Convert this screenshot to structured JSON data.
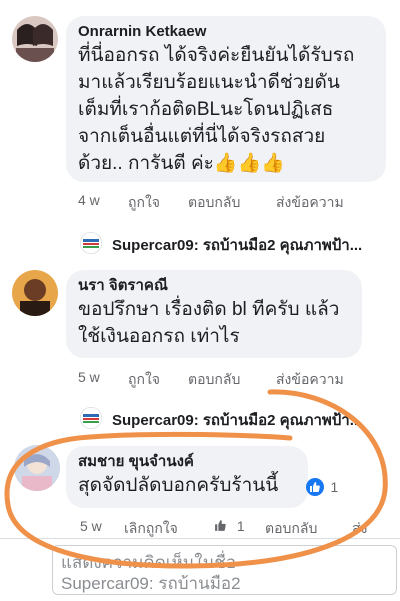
{
  "comments": [
    {
      "author": "Onrarnin Ketkaew",
      "text": "ที่นี่ออกรถ ได้จริงค่ะยืนยันได้รับรถ\nมาแล้วเรียบร้อยแนะนำดีช่วยดัน\nเต็มที่เราก้อติดBLนะโดนปฏิเสธ\nจากเต็นอื่นแต่ที่นี่ได้จริงรถสวย\nด้วย.. การันตี ค่ะ👍👍👍",
      "time": "4 w",
      "like": "ถูกใจ",
      "reply": "ตอบกลับ",
      "message": "ส่งข้อความ"
    },
    {
      "author": "นรา จิตราคณี",
      "text": "ขอปรึกษา เรื่องติด bl  ทีครับ แล้ว\nใช้เงินออกรถ เท่าไร",
      "time": "5 w",
      "like": "ถูกใจ",
      "reply": "ตอบกลับ",
      "message": "ส่งข้อความ"
    },
    {
      "author": "สมชาย ขุนจำนงค์",
      "text": "สุดจัดปลัดบอกครับร้านนี้",
      "time": "5 w",
      "unlike": "เลิกถูกใจ",
      "reaction_count": "1",
      "inline_reaction_count": "1",
      "reply": "ตอบกลับ",
      "message": "ส่ง"
    }
  ],
  "replies": [
    {
      "text": "Supercar09: รถบ้านมือ2 คุณภาพป้า..."
    },
    {
      "text": "Supercar09: รถบ้านมือ2 คุณภาพป้า..."
    }
  ],
  "comment_input": {
    "placeholder_line1": "แสดงความคิดเห็นในชื่อ",
    "placeholder_line2": "Supercar09: รถบ้านมือ2"
  },
  "colors": {
    "bubble": "#f0f2f5",
    "meta_text": "#65676b",
    "like_blue": "#1877f2",
    "annotation_orange": "#f0914a"
  }
}
